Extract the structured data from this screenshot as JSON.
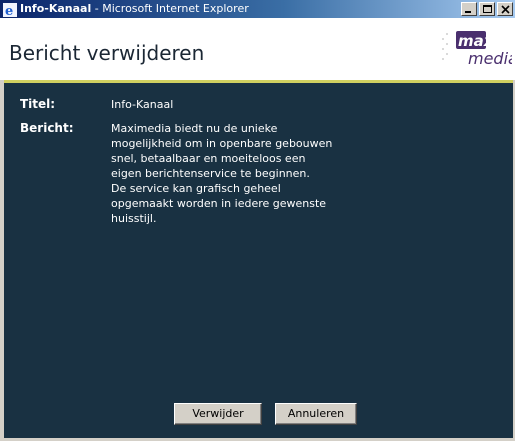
{
  "window": {
    "app_icon": "ie-icon",
    "title_main": "Info-Kanaal",
    "title_sep": " - ",
    "title_app": "Microsoft Internet Explorer",
    "controls": [
      "minimize-icon",
      "maximize-icon",
      "close-icon"
    ]
  },
  "header": {
    "title": "Bericht verwijderen",
    "logo_line1": "maxi",
    "logo_line2": "media"
  },
  "fields": {
    "title_label": "Titel:",
    "title_value": "Info-Kanaal",
    "message_label": "Bericht:",
    "message_lines": [
      "Maximedia biedt nu de unieke",
      "mogelijkheid om in openbare gebouwen",
      "snel, betaalbaar en moeiteloos een",
      "eigen berichtenservice te beginnen.",
      "De service kan grafisch geheel",
      "opgemaakt worden in iedere gewenste",
      "huisstijl."
    ]
  },
  "buttons": {
    "delete_label": "Verwijder",
    "cancel_label": "Annuleren"
  },
  "colors": {
    "panel": "#193142",
    "accent": "#d0d060",
    "titlebar_start": "#0a246a",
    "titlebar_end": "#a6caf0",
    "logo_purple": "#4a2f6e"
  }
}
